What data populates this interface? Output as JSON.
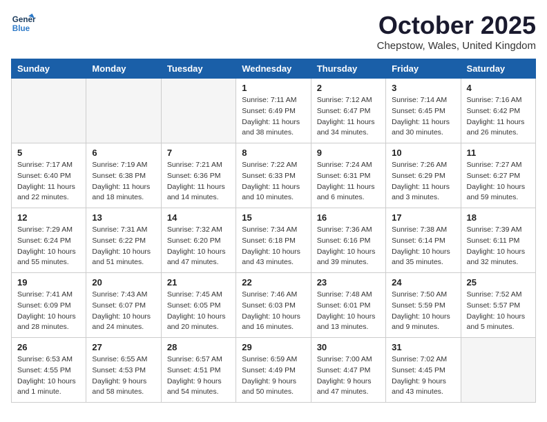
{
  "header": {
    "logo_line1": "General",
    "logo_line2": "Blue",
    "month": "October 2025",
    "location": "Chepstow, Wales, United Kingdom"
  },
  "weekdays": [
    "Sunday",
    "Monday",
    "Tuesday",
    "Wednesday",
    "Thursday",
    "Friday",
    "Saturday"
  ],
  "weeks": [
    [
      {
        "day": "",
        "info": ""
      },
      {
        "day": "",
        "info": ""
      },
      {
        "day": "",
        "info": ""
      },
      {
        "day": "1",
        "info": "Sunrise: 7:11 AM\nSunset: 6:49 PM\nDaylight: 11 hours\nand 38 minutes."
      },
      {
        "day": "2",
        "info": "Sunrise: 7:12 AM\nSunset: 6:47 PM\nDaylight: 11 hours\nand 34 minutes."
      },
      {
        "day": "3",
        "info": "Sunrise: 7:14 AM\nSunset: 6:45 PM\nDaylight: 11 hours\nand 30 minutes."
      },
      {
        "day": "4",
        "info": "Sunrise: 7:16 AM\nSunset: 6:42 PM\nDaylight: 11 hours\nand 26 minutes."
      }
    ],
    [
      {
        "day": "5",
        "info": "Sunrise: 7:17 AM\nSunset: 6:40 PM\nDaylight: 11 hours\nand 22 minutes."
      },
      {
        "day": "6",
        "info": "Sunrise: 7:19 AM\nSunset: 6:38 PM\nDaylight: 11 hours\nand 18 minutes."
      },
      {
        "day": "7",
        "info": "Sunrise: 7:21 AM\nSunset: 6:36 PM\nDaylight: 11 hours\nand 14 minutes."
      },
      {
        "day": "8",
        "info": "Sunrise: 7:22 AM\nSunset: 6:33 PM\nDaylight: 11 hours\nand 10 minutes."
      },
      {
        "day": "9",
        "info": "Sunrise: 7:24 AM\nSunset: 6:31 PM\nDaylight: 11 hours\nand 6 minutes."
      },
      {
        "day": "10",
        "info": "Sunrise: 7:26 AM\nSunset: 6:29 PM\nDaylight: 11 hours\nand 3 minutes."
      },
      {
        "day": "11",
        "info": "Sunrise: 7:27 AM\nSunset: 6:27 PM\nDaylight: 10 hours\nand 59 minutes."
      }
    ],
    [
      {
        "day": "12",
        "info": "Sunrise: 7:29 AM\nSunset: 6:24 PM\nDaylight: 10 hours\nand 55 minutes."
      },
      {
        "day": "13",
        "info": "Sunrise: 7:31 AM\nSunset: 6:22 PM\nDaylight: 10 hours\nand 51 minutes."
      },
      {
        "day": "14",
        "info": "Sunrise: 7:32 AM\nSunset: 6:20 PM\nDaylight: 10 hours\nand 47 minutes."
      },
      {
        "day": "15",
        "info": "Sunrise: 7:34 AM\nSunset: 6:18 PM\nDaylight: 10 hours\nand 43 minutes."
      },
      {
        "day": "16",
        "info": "Sunrise: 7:36 AM\nSunset: 6:16 PM\nDaylight: 10 hours\nand 39 minutes."
      },
      {
        "day": "17",
        "info": "Sunrise: 7:38 AM\nSunset: 6:14 PM\nDaylight: 10 hours\nand 35 minutes."
      },
      {
        "day": "18",
        "info": "Sunrise: 7:39 AM\nSunset: 6:11 PM\nDaylight: 10 hours\nand 32 minutes."
      }
    ],
    [
      {
        "day": "19",
        "info": "Sunrise: 7:41 AM\nSunset: 6:09 PM\nDaylight: 10 hours\nand 28 minutes."
      },
      {
        "day": "20",
        "info": "Sunrise: 7:43 AM\nSunset: 6:07 PM\nDaylight: 10 hours\nand 24 minutes."
      },
      {
        "day": "21",
        "info": "Sunrise: 7:45 AM\nSunset: 6:05 PM\nDaylight: 10 hours\nand 20 minutes."
      },
      {
        "day": "22",
        "info": "Sunrise: 7:46 AM\nSunset: 6:03 PM\nDaylight: 10 hours\nand 16 minutes."
      },
      {
        "day": "23",
        "info": "Sunrise: 7:48 AM\nSunset: 6:01 PM\nDaylight: 10 hours\nand 13 minutes."
      },
      {
        "day": "24",
        "info": "Sunrise: 7:50 AM\nSunset: 5:59 PM\nDaylight: 10 hours\nand 9 minutes."
      },
      {
        "day": "25",
        "info": "Sunrise: 7:52 AM\nSunset: 5:57 PM\nDaylight: 10 hours\nand 5 minutes."
      }
    ],
    [
      {
        "day": "26",
        "info": "Sunrise: 6:53 AM\nSunset: 4:55 PM\nDaylight: 10 hours\nand 1 minute."
      },
      {
        "day": "27",
        "info": "Sunrise: 6:55 AM\nSunset: 4:53 PM\nDaylight: 9 hours\nand 58 minutes."
      },
      {
        "day": "28",
        "info": "Sunrise: 6:57 AM\nSunset: 4:51 PM\nDaylight: 9 hours\nand 54 minutes."
      },
      {
        "day": "29",
        "info": "Sunrise: 6:59 AM\nSunset: 4:49 PM\nDaylight: 9 hours\nand 50 minutes."
      },
      {
        "day": "30",
        "info": "Sunrise: 7:00 AM\nSunset: 4:47 PM\nDaylight: 9 hours\nand 47 minutes."
      },
      {
        "day": "31",
        "info": "Sunrise: 7:02 AM\nSunset: 4:45 PM\nDaylight: 9 hours\nand 43 minutes."
      },
      {
        "day": "",
        "info": ""
      }
    ]
  ]
}
